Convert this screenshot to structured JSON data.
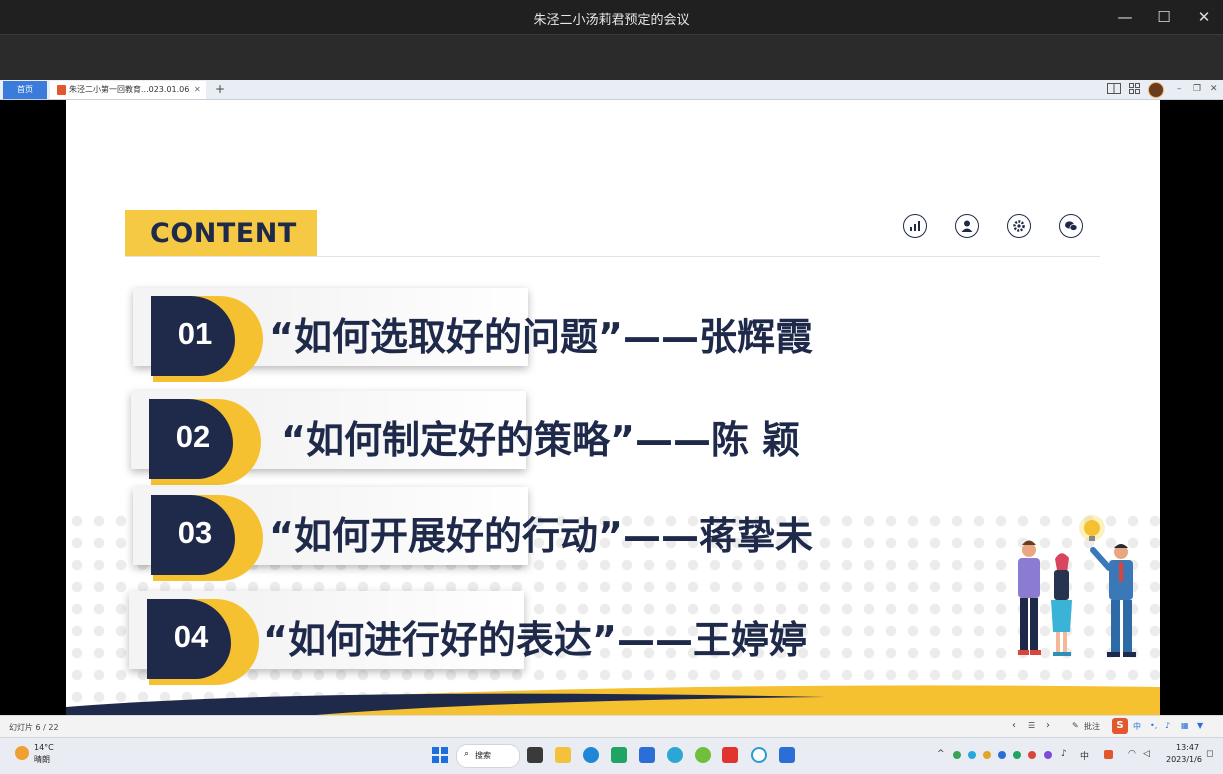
{
  "window": {
    "title": "朱泾二小汤莉君预定的会议",
    "minimize": "—",
    "maximize": "☐",
    "close": "✕"
  },
  "tabbar": {
    "home_tab": "首页",
    "doc_tab": "朱泾二小第一回教育...023.01.06",
    "new_tab": "+",
    "close_tab": "✕"
  },
  "slide": {
    "heading": "CONTENT",
    "items": [
      {
        "num": "01",
        "text": "“如何选取好的问题”——张辉霞"
      },
      {
        "num": "02",
        "text": "“如何制定好的策略”——陈 颖"
      },
      {
        "num": "03",
        "text": "“如何开展好的行动”——蒋挚未"
      },
      {
        "num": "04",
        "text": "“如何进行好的表达”——王婷婷"
      }
    ],
    "colors": {
      "navy": "#1f2a4b",
      "yellow": "#f6c131"
    }
  },
  "statusbar": {
    "slide_counter": "幻灯片 6 / 22",
    "annotate": "批注",
    "ime": "中"
  },
  "taskbar": {
    "weather_temp": "14°C",
    "weather_desc": "晴朗",
    "search": "搜索",
    "tray_lang": "中",
    "time": "13:47",
    "date": "2023/1/6"
  }
}
